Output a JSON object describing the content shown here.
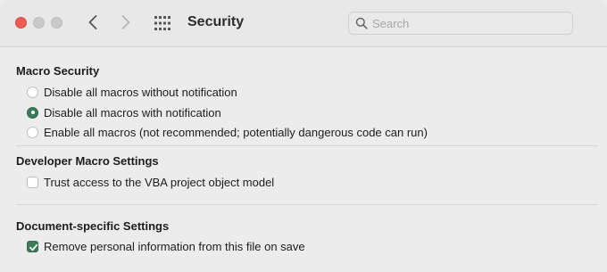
{
  "window": {
    "title": "Security",
    "controls": [
      "close",
      "minimize",
      "maximize"
    ]
  },
  "toolbar": {
    "back_icon": "chevron-left-icon",
    "forward_icon": "chevron-right-icon",
    "grid_icon": "app-grid-icon"
  },
  "search": {
    "placeholder": "Search",
    "value": ""
  },
  "sections": {
    "macro": {
      "title": "Macro Security",
      "options": [
        {
          "label": "Disable all macros without notification",
          "selected": false
        },
        {
          "label": "Disable all macros with notification",
          "selected": true
        },
        {
          "label": "Enable all macros (not recommended; potentially dangerous code can run)",
          "selected": false
        }
      ]
    },
    "developer": {
      "title": "Developer Macro Settings",
      "options": [
        {
          "label": "Trust access to the VBA project object model",
          "checked": false
        }
      ]
    },
    "document": {
      "title": "Document-specific Settings",
      "options": [
        {
          "label": "Remove personal information from this file on save",
          "checked": true
        }
      ]
    }
  },
  "colors": {
    "accent": "#3d7a5a",
    "close_button": "#ee5c55"
  }
}
